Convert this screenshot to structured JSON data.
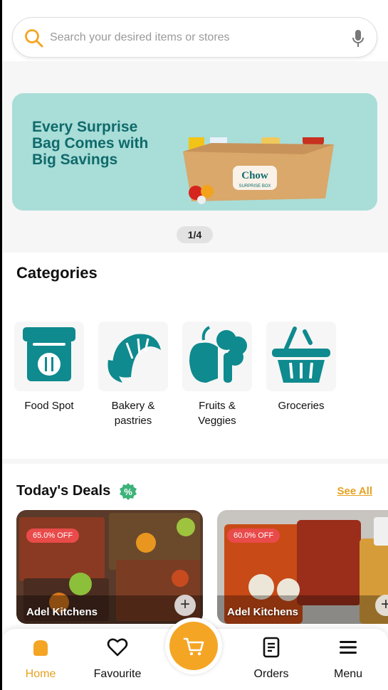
{
  "search": {
    "placeholder": "Search your desired items or stores"
  },
  "banner": {
    "headline": "Every Surprise Bag Comes with Big Savings",
    "box_brand": "Chow",
    "box_sub": "SURPRISE BOX",
    "pager": "1/4"
  },
  "categories": {
    "title": "Categories",
    "items": [
      {
        "label": "Food Spot",
        "icon": "takeaway-bag-icon"
      },
      {
        "label": "Bakery & pastries",
        "icon": "croissant-icon"
      },
      {
        "label": "Fruits & Veggies",
        "icon": "apple-broccoli-icon"
      },
      {
        "label": "Groceries",
        "icon": "basket-icon"
      }
    ]
  },
  "deals": {
    "title": "Today's Deals",
    "see_all": "See All",
    "cards": [
      {
        "discount": "65.0% OFF",
        "store": "Adel Kitchens"
      },
      {
        "discount": "60.0% OFF",
        "store": "Adel Kitchens"
      }
    ]
  },
  "nav": {
    "home": "Home",
    "favourite": "Favourite",
    "orders": "Orders",
    "menu": "Menu"
  },
  "colors": {
    "accent": "#f5a524",
    "teal": "#0f8a8e",
    "banner_bg": "#a9ddd8",
    "discount": "#e94a4a"
  }
}
